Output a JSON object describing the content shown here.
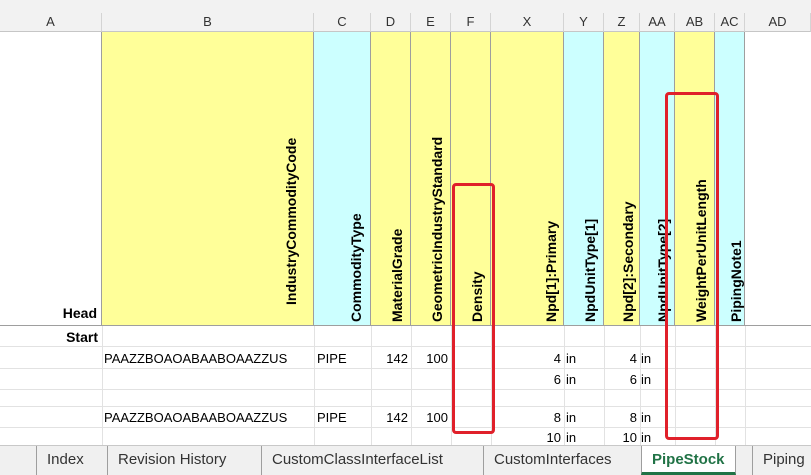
{
  "columns": [
    "A",
    "B",
    "C",
    "D",
    "E",
    "F",
    "X",
    "Y",
    "Z",
    "AA",
    "AB",
    "AC",
    "AD"
  ],
  "header_row": {
    "label": "Head",
    "cells": [
      "IndustryCommodityCode",
      "CommodityType",
      "MaterialGrade",
      "GeometricIndustryStandard",
      "Density",
      "Npd[1]:Primary",
      "NpdUnitType[1]",
      "Npd[2]:Secondary",
      "NpdUnitType[2]",
      "WeightPerUnitLength",
      "PipingNote1"
    ]
  },
  "start_label": "Start",
  "rows": [
    {
      "code": "PAAZZBOAOABAABOAAZZUS",
      "type": "PIPE",
      "grade": "142",
      "std": "100",
      "npd1": "4",
      "unit1": "in",
      "npd2": "4",
      "unit2": "in"
    },
    {
      "code": "",
      "type": "",
      "grade": "",
      "std": "",
      "npd1": "6",
      "unit1": "in",
      "npd2": "6",
      "unit2": "in"
    },
    {
      "code": "",
      "type": "",
      "grade": "",
      "std": "",
      "npd1": "",
      "unit1": "",
      "npd2": "",
      "unit2": ""
    },
    {
      "code": "PAAZZBOAOABAABOAAZZUS",
      "type": "PIPE",
      "grade": "142",
      "std": "100",
      "npd1": "8",
      "unit1": "in",
      "npd2": "8",
      "unit2": "in"
    },
    {
      "code": "",
      "type": "",
      "grade": "",
      "std": "",
      "npd1": "10",
      "unit1": "in",
      "npd2": "10",
      "unit2": "in"
    }
  ],
  "tabs": [
    "Index",
    "Revision History",
    "CustomClassInterfaceList",
    "CustomInterfaces",
    "PipeStock",
    "Piping"
  ],
  "active_tab": "PipeStock",
  "colors": {
    "header_yellow": "#ffff99",
    "header_cyan": "#ccffff",
    "highlight_red": "#e0202a",
    "active_tab_green": "#217346"
  }
}
